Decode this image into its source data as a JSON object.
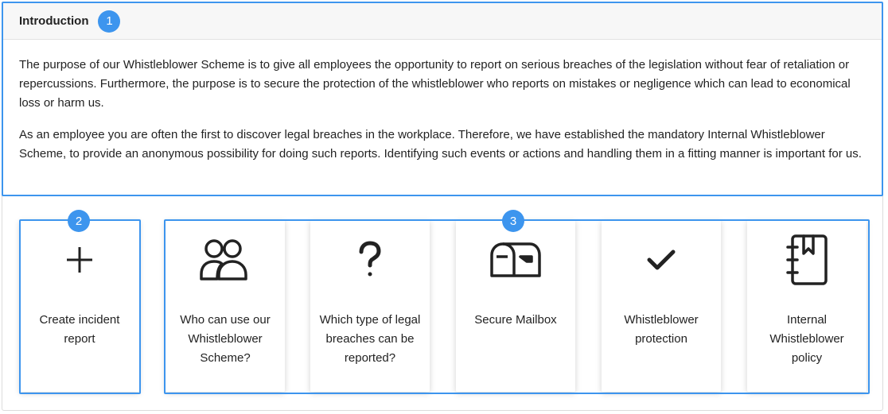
{
  "intro": {
    "title": "Introduction",
    "badge": "1",
    "paragraphs": [
      "The purpose of our Whistleblower Scheme is to give all employees the opportunity to report on serious breaches of the legislation without fear of retaliation or repercussions. Furthermore, the purpose is to secure the protection of the whistleblower who reports on mistakes or negligence which can lead to economical loss or harm us.",
      "As an employee you are often the first to discover legal breaches in the workplace. Therefore, we have established the mandatory Internal Whistleblower Scheme, to provide an anonymous possibility for doing such reports. Identifying such events or actions and handling them in a fitting manner is important for us."
    ]
  },
  "badges": {
    "create": "2",
    "group": "3"
  },
  "cards": [
    {
      "label": "Create incident report",
      "icon": "plus-icon"
    },
    {
      "label": "Who can use our Whistleblower Scheme?",
      "icon": "users-icon"
    },
    {
      "label": "Which type of legal breaches can be reported?",
      "icon": "question-icon"
    },
    {
      "label": "Secure Mailbox",
      "icon": "mailbox-icon"
    },
    {
      "label": "Whistleblower protection",
      "icon": "checkmark-icon"
    },
    {
      "label": "Internal Whistleblower policy",
      "icon": "notebook-icon"
    }
  ],
  "colors": {
    "accent": "#3d95ee",
    "icon": "#222222"
  }
}
